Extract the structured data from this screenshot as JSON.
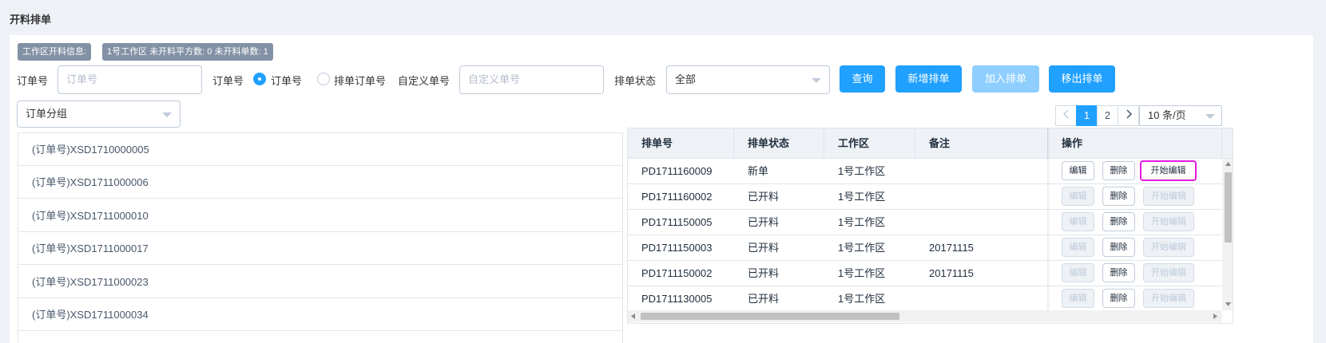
{
  "page": {
    "title": "开料排单"
  },
  "info": {
    "tag_label": "工作区开料信息:",
    "tag_value": "1号工作区 未开料平方数: 0 未开料单数: 1"
  },
  "filters": {
    "order_no_label": "订单号",
    "order_no_placeholder": "订单号",
    "order_type_label": "订单号",
    "radio_order": "订单号",
    "radio_schedule_order": "排单订单号",
    "custom_no_label": "自定义单号",
    "custom_no_placeholder": "自定义单号",
    "status_label": "排单状态",
    "status_value": "全部",
    "group_value": "订单分组"
  },
  "buttons": {
    "query": "查询",
    "new_schedule": "新增排单",
    "add_schedule": "加入排单",
    "remove_schedule": "移出排单"
  },
  "pagination": {
    "pages": [
      "1",
      "2"
    ],
    "current": "1",
    "page_size": "10 条/页"
  },
  "orders": [
    "(订单号)XSD1710000005",
    "(订单号)XSD1711000006",
    "(订单号)XSD1711000010",
    "(订单号)XSD1711000017",
    "(订单号)XSD1711000023",
    "(订单号)XSD1711000034"
  ],
  "table": {
    "headers": [
      "排单号",
      "排单状态",
      "工作区",
      "备注",
      "操作"
    ],
    "rows": [
      {
        "no": "PD1711160009",
        "status": "新单",
        "zone": "1号工作区",
        "note": ""
      },
      {
        "no": "PD1711160002",
        "status": "已开料",
        "zone": "1号工作区",
        "note": ""
      },
      {
        "no": "PD1711150005",
        "status": "已开料",
        "zone": "1号工作区",
        "note": ""
      },
      {
        "no": "PD1711150003",
        "status": "已开料",
        "zone": "1号工作区",
        "note": "20171115"
      },
      {
        "no": "PD1711150002",
        "status": "已开料",
        "zone": "1号工作区",
        "note": "20171115"
      },
      {
        "no": "PD1711130005",
        "status": "已开料",
        "zone": "1号工作区",
        "note": ""
      }
    ],
    "actions": {
      "edit": "编辑",
      "delete": "删除",
      "start_edit": "开始编辑"
    }
  },
  "colors": {
    "primary": "#20a0ff",
    "primary_disabled": "#8ecfff",
    "highlight": "#e619e0",
    "tag_bg": "#8391a5"
  }
}
